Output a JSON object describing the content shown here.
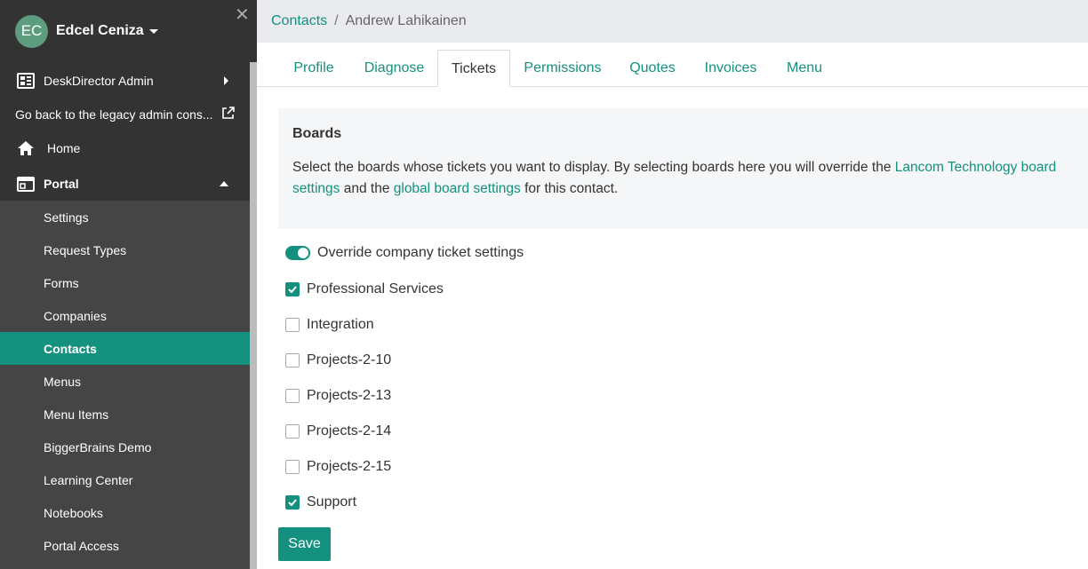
{
  "user": {
    "initials": "EC",
    "name": "Edcel Ceniza"
  },
  "sidebar": {
    "items": [
      {
        "label": "DeskDirector Admin"
      },
      {
        "label": "Go back to the legacy admin cons..."
      },
      {
        "label": "Home"
      },
      {
        "label": "Portal"
      }
    ],
    "submenu": [
      {
        "label": "Settings"
      },
      {
        "label": "Request Types"
      },
      {
        "label": "Forms"
      },
      {
        "label": "Companies"
      },
      {
        "label": "Contacts"
      },
      {
        "label": "Menus"
      },
      {
        "label": "Menu Items"
      },
      {
        "label": "BiggerBrains Demo"
      },
      {
        "label": "Learning Center"
      },
      {
        "label": "Notebooks"
      },
      {
        "label": "Portal Access"
      }
    ],
    "active_submenu": "Contacts"
  },
  "breadcrumb": {
    "parent": "Contacts",
    "separator": "/",
    "current": "Andrew Lahikainen"
  },
  "tabs": [
    {
      "label": "Profile"
    },
    {
      "label": "Diagnose"
    },
    {
      "label": "Tickets"
    },
    {
      "label": "Permissions"
    },
    {
      "label": "Quotes"
    },
    {
      "label": "Invoices"
    },
    {
      "label": "Menu"
    }
  ],
  "active_tab": "Tickets",
  "boards": {
    "title": "Boards",
    "desc_part1": "Select the boards whose tickets you want to display. By selecting boards here you will override the ",
    "link1": "Lancom Technology board settings",
    "desc_part2": " and the ",
    "link2": "global board settings",
    "desc_part3": " for this contact."
  },
  "override": {
    "label": "Override company ticket settings",
    "enabled": true
  },
  "board_list": [
    {
      "label": "Professional Services",
      "checked": true
    },
    {
      "label": "Integration",
      "checked": false
    },
    {
      "label": "Projects-2-10",
      "checked": false
    },
    {
      "label": "Projects-2-13",
      "checked": false
    },
    {
      "label": "Projects-2-14",
      "checked": false
    },
    {
      "label": "Projects-2-15",
      "checked": false
    },
    {
      "label": "Support",
      "checked": true
    }
  ],
  "save_label": "Save",
  "colors": {
    "accent": "#14917e",
    "sidebar": "#333333",
    "submenu": "#454545",
    "topbar": "#e9ebee"
  }
}
